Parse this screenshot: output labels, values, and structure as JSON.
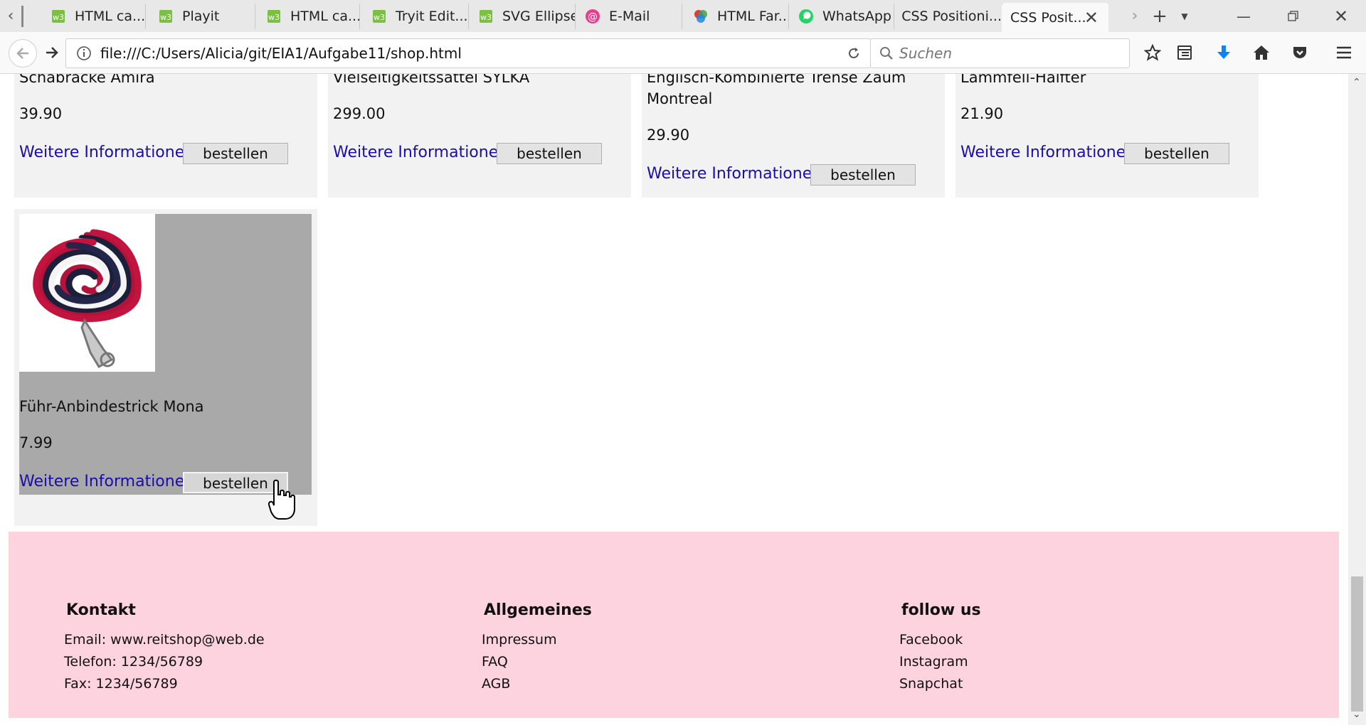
{
  "browser": {
    "tabs": [
      {
        "title": "HTML ca...",
        "icon": "w3schools-icon"
      },
      {
        "title": "Playit",
        "icon": "w3schools-icon"
      },
      {
        "title": "HTML ca...",
        "icon": "w3schools-icon"
      },
      {
        "title": "Tryit Edit...",
        "icon": "w3schools-icon"
      },
      {
        "title": "SVG Ellipse",
        "icon": "w3schools-icon"
      },
      {
        "title": "E-Mail",
        "icon": "email-at-icon"
      },
      {
        "title": "HTML Far...",
        "icon": "color-wheel-icon"
      },
      {
        "title": "WhatsApp",
        "icon": "whatsapp-icon"
      },
      {
        "title": "CSS Positioni...",
        "icon": ""
      },
      {
        "title": "CSS Posit...",
        "icon": "",
        "active": true
      }
    ],
    "url": "file:///C:/Users/Alicia/git/EIA1/Aufgabe11/shop.html",
    "search_placeholder": "Suchen",
    "accent_color": "#0a84ff"
  },
  "products": [
    {
      "name": "Schabracke Amira",
      "price": "39.90",
      "more_label": "Weitere Informationen",
      "order_label": "bestellen"
    },
    {
      "name": "Vielseitigkeitssattel SYLKA",
      "price": "299.00",
      "more_label": "Weitere Informationen",
      "order_label": "bestellen"
    },
    {
      "name": "Englisch-Kombinierte Trense Zaum Montreal",
      "price": "29.90",
      "more_label": "Weitere Informationen",
      "order_label": "bestellen"
    },
    {
      "name": "Lammfell-Halfter",
      "price": "21.90",
      "more_label": "Weitere Informationen",
      "order_label": "bestellen"
    },
    {
      "name": "Führ-Anbindestrick Mona",
      "price": "7.99",
      "more_label": "Weitere Informationen",
      "order_label": "bestellen",
      "hovered": true
    }
  ],
  "footer": {
    "background": "#fdd3e0",
    "columns": [
      {
        "heading": "Kontakt",
        "items": [
          "Email: www.reitshop@web.de",
          "Telefon: 1234/56789",
          "Fax: 1234/56789"
        ]
      },
      {
        "heading": "Allgemeines",
        "items": [
          "Impressum",
          "FAQ",
          "AGB"
        ]
      },
      {
        "heading": "follow us",
        "items": [
          "Facebook",
          "Instagram",
          "Snapchat"
        ]
      }
    ]
  }
}
